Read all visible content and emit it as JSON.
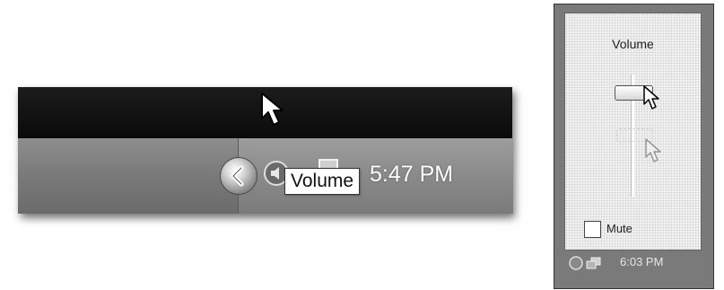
{
  "taskbar": {
    "tooltip": "Volume",
    "clock": "5:47 PM",
    "icons": [
      "show-hidden-icons-chevron",
      "speaker-icon",
      "network-icon"
    ]
  },
  "volume_popup": {
    "title": "Volume",
    "level": 0.9,
    "mute_label": "Mute",
    "mute_checked": false,
    "tray_clock": "6:03 PM"
  }
}
